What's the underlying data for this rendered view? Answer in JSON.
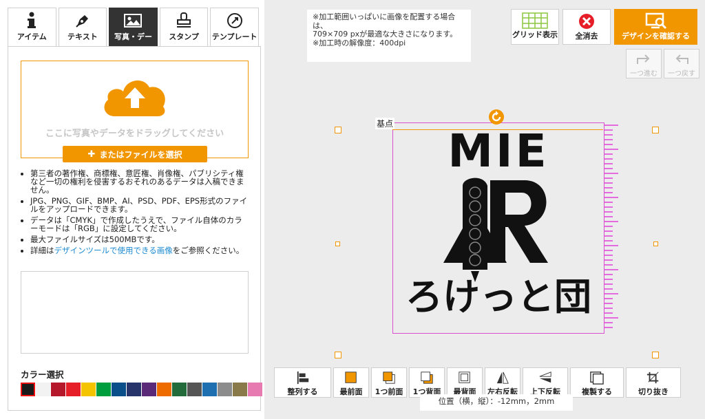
{
  "tabs": [
    {
      "label": "アイテム",
      "icon": "info-icon",
      "active": false
    },
    {
      "label": "テキスト",
      "icon": "pen-icon",
      "active": false
    },
    {
      "label": "写真・デー",
      "icon": "image-icon",
      "active": true
    },
    {
      "label": "スタンプ",
      "icon": "stamp-icon",
      "active": false
    },
    {
      "label": "テンプレート",
      "icon": "template-icon",
      "active": false
    }
  ],
  "upload": {
    "drop_text": "ここに写真やデータをドラッグしてください",
    "file_button": "またはファイルを選択"
  },
  "notes": {
    "n1": "第三者の著作権、商標権、意匠権、肖像権、パブリシティ権など一切の権利を侵害するおそれのあるデータは入稿できません。",
    "n2": "JPG、PNG、GIF、BMP、AI、PSD、PDF、EPS形式のファイルをアップロードできます。",
    "n3": "データは「CMYK」で作成したうえで、ファイル自体のカラーモードは「RGB」に設定してください。",
    "n4": "最大ファイルサイズは500MBです。",
    "n5_pre": "詳細は",
    "n5_link": "デザインツールで使用できる画像",
    "n5_post": "をご参照ください。"
  },
  "color": {
    "title": "カラー選択",
    "swatches": [
      "#1a1a1a",
      "#f2f2f2",
      "#b5182a",
      "#e61e28",
      "#f5c400",
      "#009e3d",
      "#0b4f8a",
      "#27346b",
      "#5a2a78",
      "#ee6b00",
      "#236b3a",
      "#555555",
      "#1e6fb0",
      "#8c8c8c",
      "#8a7a4a",
      "#e77ab0"
    ]
  },
  "notice": {
    "line1": "※加工範囲いっぱいに画像を配置する場合は、",
    "line2": "709×709 pxが最適な大きさになります。",
    "line3": "※加工時の解像度：400dpi"
  },
  "toolbar": {
    "grid": "グリッド表示",
    "clear": "全消去",
    "confirm": "デザインを確認する",
    "redo": "一つ進む",
    "undo": "一つ戻す"
  },
  "canvas": {
    "base_label": "基点",
    "logo_top": "MIE",
    "logo_bottom": "ろけっと団"
  },
  "bottom": {
    "align": "整列する",
    "front_most": "最前面",
    "front_one": "1つ前面",
    "back_one": "1つ背面",
    "back_most": "最背面",
    "flip_h": "左右反転",
    "flip_v": "上下反転",
    "duplicate": "複製する",
    "crop": "切り抜き"
  },
  "position": "位置（横，縦）：-12mm，2mm",
  "colors": {
    "accent": "#f29600",
    "selection": "#d84fd0",
    "link": "#1a8ad1"
  }
}
